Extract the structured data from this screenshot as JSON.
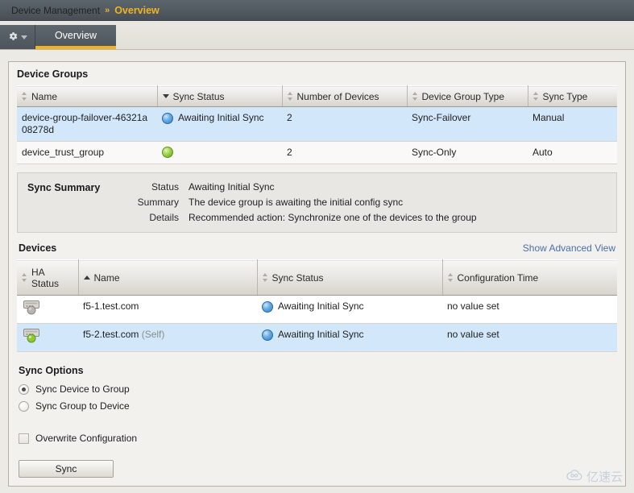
{
  "breadcrumb": {
    "root": "Device Management",
    "separator": "»",
    "current": "Overview"
  },
  "tabs": {
    "gear_icon": "gear-icon",
    "caret_icon": "chevron-down-icon",
    "overview_label": "Overview"
  },
  "device_groups": {
    "panel_title": "Device Groups",
    "columns": [
      {
        "label": "Name",
        "sort": "both"
      },
      {
        "label": "Sync Status",
        "sort": "desc"
      },
      {
        "label": "Number of Devices",
        "sort": "both"
      },
      {
        "label": "Device Group Type",
        "sort": "both"
      },
      {
        "label": "Sync Type",
        "sort": "both"
      }
    ],
    "rows": [
      {
        "name": "device-group-failover-46321a08278d",
        "sync_status": "Awaiting Initial Sync",
        "status_color": "blue",
        "number_of_devices": "2",
        "device_group_type": "Sync-Failover",
        "sync_type": "Manual",
        "selected": true
      },
      {
        "name": "device_trust_group",
        "sync_status": "",
        "status_color": "green",
        "number_of_devices": "2",
        "device_group_type": "Sync-Only",
        "sync_type": "Auto",
        "selected": false
      }
    ]
  },
  "sync_summary": {
    "title": "Sync Summary",
    "fields": [
      {
        "label": "Status",
        "value": "Awaiting Initial Sync"
      },
      {
        "label": "Summary",
        "value": "The device group is awaiting the initial config sync"
      },
      {
        "label": "Details",
        "value": "Recommended action: Synchronize one of the devices to the group"
      }
    ]
  },
  "devices": {
    "title": "Devices",
    "advanced_view_link": "Show Advanced View",
    "columns": [
      {
        "label": "HA\nStatus",
        "sort": "both"
      },
      {
        "label": "Name",
        "sort": "asc"
      },
      {
        "label": "Sync Status",
        "sort": "both"
      },
      {
        "label": "Configuration Time",
        "sort": "both"
      }
    ],
    "rows": [
      {
        "ha_status_icon": "device-status-icon",
        "ha_badge_color": "gray",
        "name": "f5-1.test.com",
        "self_tag": "",
        "sync_status": "Awaiting Initial Sync",
        "status_color": "blue",
        "configuration_time": "no value set",
        "selected": false
      },
      {
        "ha_status_icon": "device-status-icon",
        "ha_badge_color": "green",
        "name": "f5-2.test.com",
        "self_tag": "(Self)",
        "sync_status": "Awaiting Initial Sync",
        "status_color": "blue",
        "configuration_time": "no value set",
        "selected": true
      }
    ]
  },
  "sync_options": {
    "title": "Sync Options",
    "radios": [
      {
        "label": "Sync Device to Group",
        "checked": true
      },
      {
        "label": "Sync Group to Device",
        "checked": false
      }
    ],
    "checkbox": {
      "label": "Overwrite Configuration",
      "checked": false
    },
    "sync_button": "Sync"
  },
  "watermark": {
    "text": "亿速云",
    "icon": "cloud-icon"
  },
  "colors": {
    "accent_yellow": "#f0b323",
    "header_gray": "#525a62",
    "selected_row": "#d2e7f9",
    "link_blue": "#4a6fa8",
    "status_blue": "#2f7fc6",
    "status_green": "#9fd24a"
  }
}
